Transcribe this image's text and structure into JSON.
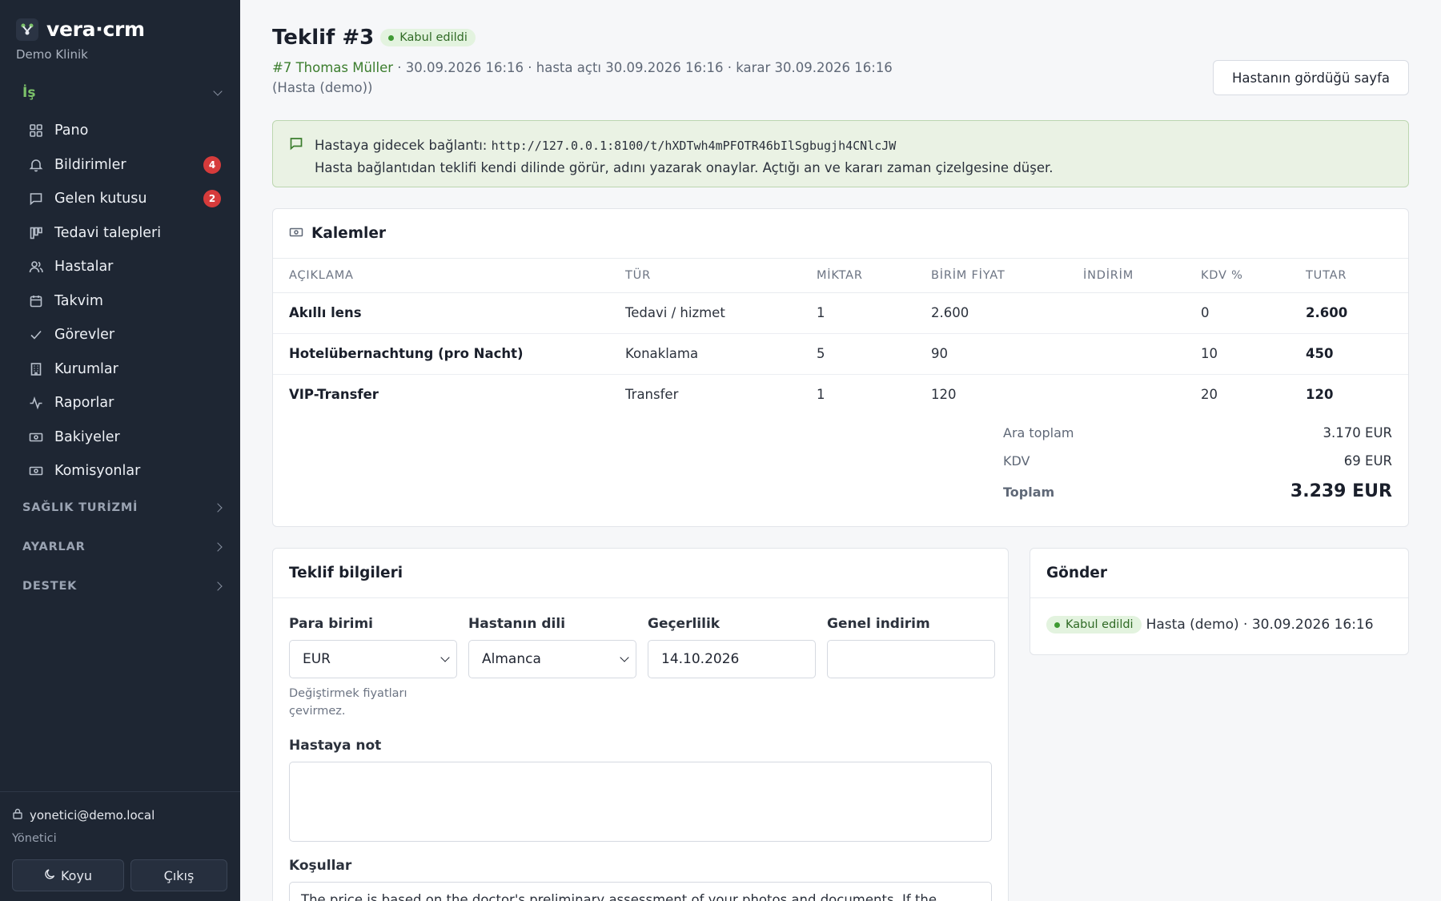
{
  "sidebar": {
    "brand": "vera·crm",
    "subtitle": "Demo Klinik",
    "open_section": "İş",
    "items": [
      {
        "label": "Pano",
        "icon": "grid-icon"
      },
      {
        "label": "Bildirimler",
        "icon": "bell-icon",
        "badge": "4"
      },
      {
        "label": "Gelen kutusu",
        "icon": "chat-icon",
        "badge": "2"
      },
      {
        "label": "Tedavi talepleri",
        "icon": "board-icon"
      },
      {
        "label": "Hastalar",
        "icon": "users-icon"
      },
      {
        "label": "Takvim",
        "icon": "calendar-icon"
      },
      {
        "label": "Görevler",
        "icon": "check-icon"
      },
      {
        "label": "Kurumlar",
        "icon": "building-icon"
      },
      {
        "label": "Raporlar",
        "icon": "activity-icon"
      },
      {
        "label": "Bakiyeler",
        "icon": "cash-icon"
      },
      {
        "label": "Komisyonlar",
        "icon": "cash-icon"
      }
    ],
    "closed_sections": [
      "SAĞLIK TURİZMİ",
      "AYARLAR",
      "DESTEK"
    ],
    "user_email": "yonetici@demo.local",
    "user_role": "Yönetici",
    "theme_button": "Koyu",
    "logout_button": "Çıkış"
  },
  "header": {
    "title": "Teklif #3",
    "status": "Kabul edildi",
    "patient_link": "#7 Thomas Müller",
    "meta": " · 30.09.2026 16:16 · hasta açtı 30.09.2026 16:16 · karar 30.09.2026 16:16 (Hasta (demo))",
    "patient_page_button": "Hastanın gördüğü sayfa"
  },
  "notice": {
    "label": "Hastaya gidecek bağlantı:",
    "url": "http://127.0.0.1:8100/t/hXDTwh4mPFOTR46bIlSgbugjh4CNlcJW",
    "text": "Hasta bağlantıdan teklifi kendi dilinde görür, adını yazarak onaylar. Açtığı an ve kararı zaman çizelgesine düşer."
  },
  "items": {
    "title": "Kalemler",
    "columns": [
      "AÇIKLAMA",
      "TÜR",
      "MİKTAR",
      "BİRİM FİYAT",
      "İNDİRİM",
      "KDV %",
      "TUTAR"
    ],
    "rows": [
      [
        "Akıllı lens",
        "Tedavi / hizmet",
        "1",
        "2.600",
        "",
        "0",
        "2.600"
      ],
      [
        "Hotelübernachtung (pro Nacht)",
        "Konaklama",
        "5",
        "90",
        "",
        "10",
        "450"
      ],
      [
        "VIP-Transfer",
        "Transfer",
        "1",
        "120",
        "",
        "20",
        "120"
      ]
    ],
    "subtotal_label": "Ara toplam",
    "subtotal": "3.170 EUR",
    "vat_label": "KDV",
    "vat": "69 EUR",
    "total_label": "Toplam",
    "total": "3.239 EUR"
  },
  "info": {
    "title": "Teklif bilgileri",
    "currency_label": "Para birimi",
    "currency_value": "EUR",
    "currency_hint": "Değiştirmek fiyatları çevirmez.",
    "language_label": "Hastanın dili",
    "language_value": "Almanca",
    "validity_label": "Geçerlilik",
    "validity_value": "14.10.2026",
    "discount_label": "Genel indirim",
    "discount_value": "",
    "note_label": "Hastaya not",
    "conditions_label": "Koşullar",
    "conditions_value": "The price is based on the doctor's preliminary assessment of your photos and documents. If the"
  },
  "send": {
    "title": "Gönder",
    "status": "Kabul edildi",
    "detail": "Hasta (demo) · 30.09.2026 16:16"
  }
}
